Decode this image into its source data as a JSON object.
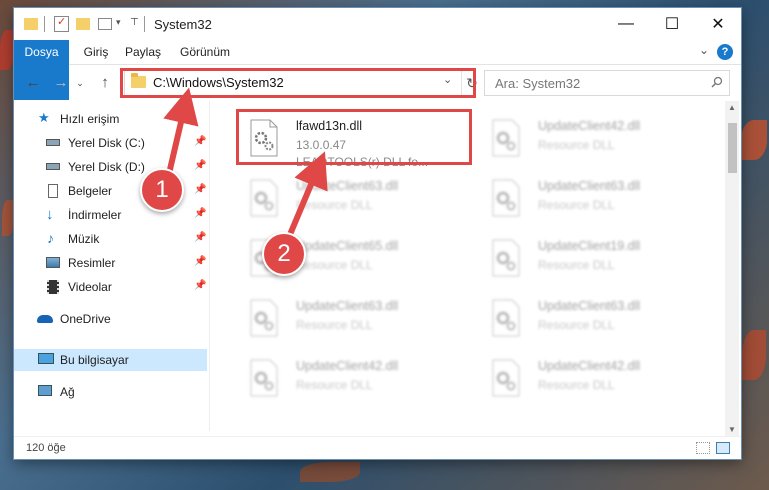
{
  "window": {
    "title": "System32"
  },
  "ribbon": {
    "tabs": [
      "Dosya",
      "Giriş",
      "Paylaş",
      "Görünüm"
    ]
  },
  "nav": {
    "address": "C:\\Windows\\System32",
    "search_placeholder": "Ara: System32"
  },
  "sidebar": {
    "items": [
      {
        "label": "Hızlı erişim",
        "icon": "star-icon"
      },
      {
        "label": "Yerel Disk (C:)",
        "icon": "drive-icon"
      },
      {
        "label": "Yerel Disk (D:)",
        "icon": "drive-icon"
      },
      {
        "label": "Belgeler",
        "icon": "document-icon"
      },
      {
        "label": "İndirmeler",
        "icon": "download-icon"
      },
      {
        "label": "Müzik",
        "icon": "music-icon"
      },
      {
        "label": "Resimler",
        "icon": "pictures-icon"
      },
      {
        "label": "Videolar",
        "icon": "video-icon"
      },
      {
        "label": "OneDrive",
        "icon": "cloud-icon"
      },
      {
        "label": "Bu bilgisayar",
        "icon": "computer-icon"
      },
      {
        "label": "Ağ",
        "icon": "network-icon"
      }
    ]
  },
  "files": {
    "highlighted": {
      "name": "lfawd13n.dll",
      "version": "13.0.0.47",
      "description": "LEADTOOLS(r) DLL fo..."
    },
    "blurred": [
      {
        "name": "UpdateClient42.dll",
        "type": "Resource DLL"
      },
      {
        "name": "UpdateClient63.dll",
        "type": "Resource DLL"
      },
      {
        "name": "UpdateClient63.dll",
        "type": "Resource DLL"
      },
      {
        "name": "UpdateClient65.dll",
        "type": "Resource DLL"
      },
      {
        "name": "UpdateClient19.dll",
        "type": "Resource DLL"
      },
      {
        "name": "UpdateClient63.dll",
        "type": "Resource DLL"
      },
      {
        "name": "UpdateClient63.dll",
        "type": "Resource DLL"
      },
      {
        "name": "UpdateClient42.dll",
        "type": "Resource DLL"
      },
      {
        "name": "UpdateClient42.dll",
        "type": "Resource DLL"
      }
    ]
  },
  "status": {
    "item_count": "120 öğe"
  },
  "annotations": {
    "step1": "1",
    "step2": "2"
  },
  "colors": {
    "accent": "#1979ca",
    "highlight": "#e04848",
    "selected": "#cce8ff"
  }
}
